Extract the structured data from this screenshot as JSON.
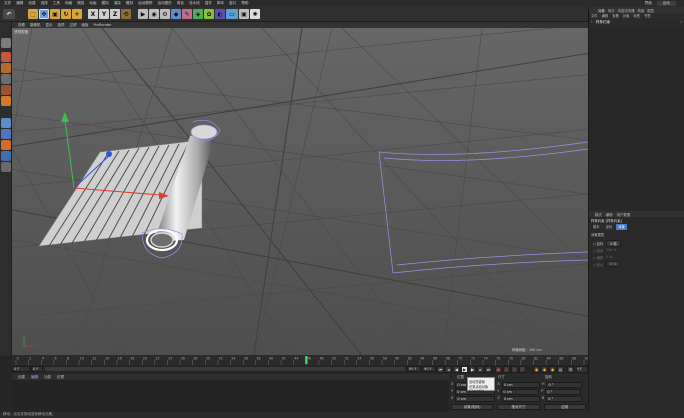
{
  "menubar": {
    "items": [
      "文件",
      "编辑",
      "创建",
      "选择",
      "工具",
      "网格",
      "捕捉",
      "动画",
      "模拟",
      "渲染",
      "雕刻",
      "运动跟踪",
      "运动图形",
      "角色",
      "流水线",
      "插件",
      "脚本",
      "窗口",
      "帮助"
    ],
    "layout_label": "界面",
    "layout_value": "启动"
  },
  "toolbar": {
    "axis_x": "X",
    "axis_y": "Y",
    "axis_z": "Z"
  },
  "viewport": {
    "menu": [
      "查看",
      "摄像机",
      "显示",
      "选项",
      "过滤",
      "面板",
      "ProRender"
    ],
    "label": "透视视图",
    "grid_spacing": "网格间距：100 cm"
  },
  "timeline": {
    "ticks": [
      "0",
      "2",
      "4",
      "6",
      "8",
      "10",
      "12",
      "14",
      "16",
      "18",
      "20",
      "22",
      "24",
      "26",
      "28",
      "30",
      "32",
      "34",
      "36",
      "38",
      "40",
      "42",
      "44",
      "46",
      "48",
      "50",
      "52",
      "54",
      "56",
      "58",
      "60",
      "62",
      "64",
      "66",
      "68",
      "70",
      "72",
      "74",
      "76",
      "78",
      "80",
      "82",
      "84",
      "86",
      "88",
      "90"
    ],
    "current_frame_marker": 46,
    "start_field": "0 F",
    "mid_field": "0 F",
    "end_field": "90 F",
    "end_field2": "90 F",
    "frame_counter": "0 F"
  },
  "material": {
    "tabs": [
      "创建",
      "编辑",
      "功能",
      "纹理"
    ]
  },
  "coordinates": {
    "headers": [
      "位置",
      "尺寸",
      "旋转"
    ],
    "rows": [
      {
        "axis": "X",
        "pos": "0 cm",
        "size": "0 cm",
        "rot_axis": "H",
        "rot": "0 °"
      },
      {
        "axis": "Y",
        "pos": "0 cm",
        "size": "0 cm",
        "rot_axis": "P",
        "rot": "0 °"
      },
      {
        "axis": "Z",
        "pos": "0 cm",
        "size": "0 cm",
        "rot_axis": "B",
        "rot": "0 °"
      }
    ],
    "buttons": [
      "对象(相对)",
      "绝对尺寸",
      "应用"
    ]
  },
  "tooltip": {
    "lines": [
      "自动关键帧",
      "记录活动对象",
      "[Ctrl+F9]"
    ]
  },
  "objects": {
    "tabs": [
      "对象",
      "场次",
      "内容浏览器",
      "构造",
      "图层"
    ],
    "menu": [
      "文件",
      "编辑",
      "查看",
      "对象",
      "标签",
      "书签"
    ],
    "item_name": "样条约束"
  },
  "attributes": {
    "tabs": [
      "模式",
      "编辑",
      "用户数据"
    ],
    "header": "样条约束 [样条约束]",
    "subtabs": [
      "基本",
      "坐标",
      "对象"
    ],
    "section": "对象属性",
    "rows": [
      {
        "label": "○ 旋转",
        "value": "X 轴",
        "dim": false
      },
      {
        "label": "○ 强度",
        "value": "100 %",
        "dim": true
      },
      {
        "label": "○ 偏移",
        "value": "0 %",
        "dim": true
      },
      {
        "label": "○ 起点",
        "value": "0 %",
        "dim": true
      },
      {
        "label": "○ 终点",
        "value": "100 %",
        "dim": true
      }
    ]
  },
  "status": {
    "text": "移动：点击并拖动鼠标移动元素。"
  },
  "colors": {
    "viewport_bg": "#5a5a5a",
    "accent": "#4a79c7",
    "axis_x": "#e23b2f",
    "axis_y": "#36c24a",
    "axis_z": "#2c56e0",
    "selection": "#9d8fe8"
  }
}
